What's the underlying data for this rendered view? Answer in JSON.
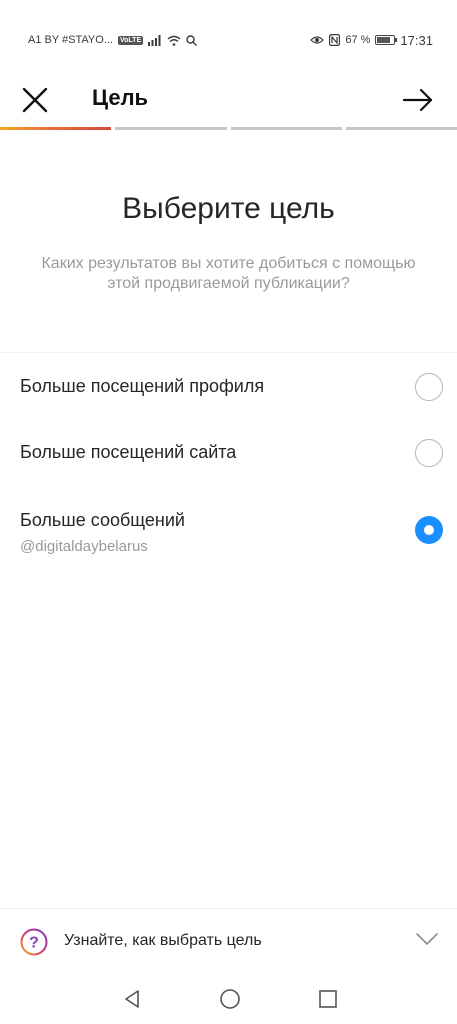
{
  "status_bar": {
    "carrier": "A1 BY #STAYO...",
    "volte_badge": "VoLTE",
    "battery_percent": "67 %",
    "battery_level": 0.67,
    "time": "17:31",
    "icons": [
      "signal-icon",
      "wifi-icon",
      "search-icon",
      "eye-icon",
      "nfc-icon",
      "battery-icon"
    ]
  },
  "header": {
    "title": "Цель",
    "close_icon": "close-icon",
    "next_icon": "arrow-right-icon"
  },
  "progress": {
    "total_steps": 4,
    "current_step": 1,
    "active_colors": [
      "#f5a623",
      "#e56a3b",
      "#d4483f"
    ],
    "inactive_color": "#c7c7c7"
  },
  "main": {
    "title": "Выберите цель",
    "subtitle": "Каких результатов вы хотите добиться с помощью этой продвигаемой публикации?"
  },
  "options": [
    {
      "label": "Больше посещений профиля",
      "sublabel": "",
      "selected": false
    },
    {
      "label": "Больше посещений сайта",
      "sublabel": "",
      "selected": false
    },
    {
      "label": "Больше сообщений",
      "sublabel": "@digitaldaybelarus",
      "selected": true
    }
  ],
  "accent_color": "#1a8fff",
  "help": {
    "text": "Узнайте, как выбрать цель",
    "icon": "question-circle-icon",
    "chevron": "chevron-down-icon"
  },
  "nav_bar": {
    "buttons": [
      "back-triangle-icon",
      "home-circle-icon",
      "recents-square-icon"
    ]
  }
}
